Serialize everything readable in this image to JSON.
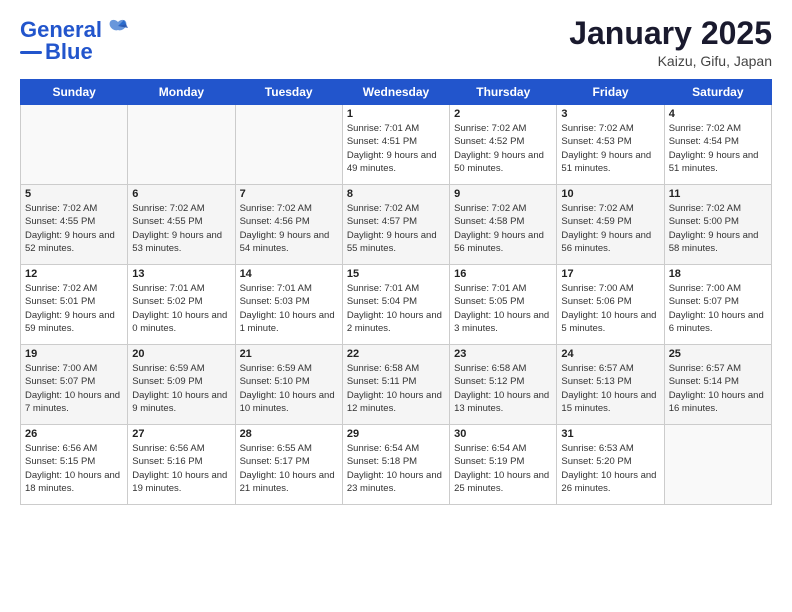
{
  "header": {
    "logo_line1": "General",
    "logo_line2": "Blue",
    "title": "January 2025",
    "subtitle": "Kaizu, Gifu, Japan"
  },
  "weekdays": [
    "Sunday",
    "Monday",
    "Tuesday",
    "Wednesday",
    "Thursday",
    "Friday",
    "Saturday"
  ],
  "weeks": [
    [
      {
        "day": "",
        "sunrise": "",
        "sunset": "",
        "daylight": ""
      },
      {
        "day": "",
        "sunrise": "",
        "sunset": "",
        "daylight": ""
      },
      {
        "day": "",
        "sunrise": "",
        "sunset": "",
        "daylight": ""
      },
      {
        "day": "1",
        "sunrise": "7:01 AM",
        "sunset": "4:51 PM",
        "daylight": "9 hours and 49 minutes."
      },
      {
        "day": "2",
        "sunrise": "7:02 AM",
        "sunset": "4:52 PM",
        "daylight": "9 hours and 50 minutes."
      },
      {
        "day": "3",
        "sunrise": "7:02 AM",
        "sunset": "4:53 PM",
        "daylight": "9 hours and 51 minutes."
      },
      {
        "day": "4",
        "sunrise": "7:02 AM",
        "sunset": "4:54 PM",
        "daylight": "9 hours and 51 minutes."
      }
    ],
    [
      {
        "day": "5",
        "sunrise": "7:02 AM",
        "sunset": "4:55 PM",
        "daylight": "9 hours and 52 minutes."
      },
      {
        "day": "6",
        "sunrise": "7:02 AM",
        "sunset": "4:55 PM",
        "daylight": "9 hours and 53 minutes."
      },
      {
        "day": "7",
        "sunrise": "7:02 AM",
        "sunset": "4:56 PM",
        "daylight": "9 hours and 54 minutes."
      },
      {
        "day": "8",
        "sunrise": "7:02 AM",
        "sunset": "4:57 PM",
        "daylight": "9 hours and 55 minutes."
      },
      {
        "day": "9",
        "sunrise": "7:02 AM",
        "sunset": "4:58 PM",
        "daylight": "9 hours and 56 minutes."
      },
      {
        "day": "10",
        "sunrise": "7:02 AM",
        "sunset": "4:59 PM",
        "daylight": "9 hours and 56 minutes."
      },
      {
        "day": "11",
        "sunrise": "7:02 AM",
        "sunset": "5:00 PM",
        "daylight": "9 hours and 58 minutes."
      }
    ],
    [
      {
        "day": "12",
        "sunrise": "7:02 AM",
        "sunset": "5:01 PM",
        "daylight": "9 hours and 59 minutes."
      },
      {
        "day": "13",
        "sunrise": "7:01 AM",
        "sunset": "5:02 PM",
        "daylight": "10 hours and 0 minutes."
      },
      {
        "day": "14",
        "sunrise": "7:01 AM",
        "sunset": "5:03 PM",
        "daylight": "10 hours and 1 minute."
      },
      {
        "day": "15",
        "sunrise": "7:01 AM",
        "sunset": "5:04 PM",
        "daylight": "10 hours and 2 minutes."
      },
      {
        "day": "16",
        "sunrise": "7:01 AM",
        "sunset": "5:05 PM",
        "daylight": "10 hours and 3 minutes."
      },
      {
        "day": "17",
        "sunrise": "7:00 AM",
        "sunset": "5:06 PM",
        "daylight": "10 hours and 5 minutes."
      },
      {
        "day": "18",
        "sunrise": "7:00 AM",
        "sunset": "5:07 PM",
        "daylight": "10 hours and 6 minutes."
      }
    ],
    [
      {
        "day": "19",
        "sunrise": "7:00 AM",
        "sunset": "5:07 PM",
        "daylight": "10 hours and 7 minutes."
      },
      {
        "day": "20",
        "sunrise": "6:59 AM",
        "sunset": "5:09 PM",
        "daylight": "10 hours and 9 minutes."
      },
      {
        "day": "21",
        "sunrise": "6:59 AM",
        "sunset": "5:10 PM",
        "daylight": "10 hours and 10 minutes."
      },
      {
        "day": "22",
        "sunrise": "6:58 AM",
        "sunset": "5:11 PM",
        "daylight": "10 hours and 12 minutes."
      },
      {
        "day": "23",
        "sunrise": "6:58 AM",
        "sunset": "5:12 PM",
        "daylight": "10 hours and 13 minutes."
      },
      {
        "day": "24",
        "sunrise": "6:57 AM",
        "sunset": "5:13 PM",
        "daylight": "10 hours and 15 minutes."
      },
      {
        "day": "25",
        "sunrise": "6:57 AM",
        "sunset": "5:14 PM",
        "daylight": "10 hours and 16 minutes."
      }
    ],
    [
      {
        "day": "26",
        "sunrise": "6:56 AM",
        "sunset": "5:15 PM",
        "daylight": "10 hours and 18 minutes."
      },
      {
        "day": "27",
        "sunrise": "6:56 AM",
        "sunset": "5:16 PM",
        "daylight": "10 hours and 19 minutes."
      },
      {
        "day": "28",
        "sunrise": "6:55 AM",
        "sunset": "5:17 PM",
        "daylight": "10 hours and 21 minutes."
      },
      {
        "day": "29",
        "sunrise": "6:54 AM",
        "sunset": "5:18 PM",
        "daylight": "10 hours and 23 minutes."
      },
      {
        "day": "30",
        "sunrise": "6:54 AM",
        "sunset": "5:19 PM",
        "daylight": "10 hours and 25 minutes."
      },
      {
        "day": "31",
        "sunrise": "6:53 AM",
        "sunset": "5:20 PM",
        "daylight": "10 hours and 26 minutes."
      },
      {
        "day": "",
        "sunrise": "",
        "sunset": "",
        "daylight": ""
      }
    ]
  ]
}
